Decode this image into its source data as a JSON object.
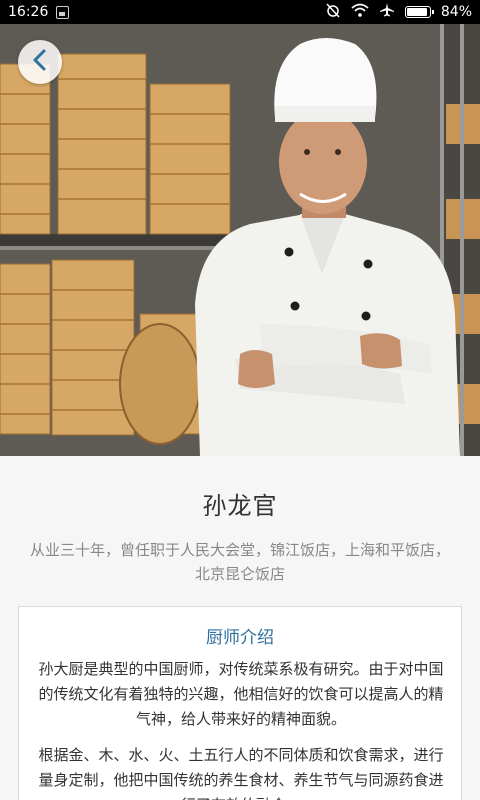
{
  "status_bar": {
    "time": "16:26",
    "battery": "84%"
  },
  "nav": {
    "back_icon": "chevron-left-icon"
  },
  "chef": {
    "name": "孙龙官",
    "bio": "从业三十年，曾任职于人民大会堂，锦江饭店，上海和平饭店，北京昆仑饭店"
  },
  "intro": {
    "title": "厨师介绍",
    "paragraphs": [
      "孙大厨是典型的中国厨师，对传统菜系极有研究。由于对中国的传统文化有着独特的兴趣，他相信好的饮食可以提高人的精气神，给人带来好的精神面貌。",
      "根据金、木、水、火、土五行人的不同体质和饮食需求，进行量身定制，他把中国传统的养生食材、养生节气与同源药食进行了有效的融合。"
    ]
  },
  "colors": {
    "accent": "#2c6f9e",
    "background": "#f6f6f6"
  }
}
